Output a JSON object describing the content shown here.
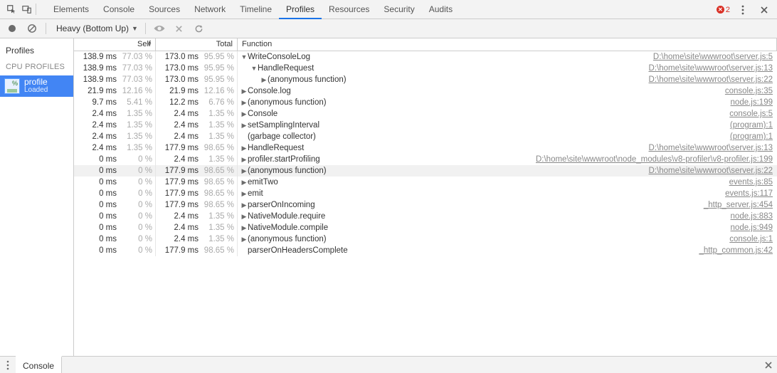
{
  "topbar": {
    "tabs": [
      "Elements",
      "Console",
      "Sources",
      "Network",
      "Timeline",
      "Profiles",
      "Resources",
      "Security",
      "Audits"
    ],
    "active_tab": "Profiles",
    "error_count": "2"
  },
  "toolbar": {
    "view_label": "Heavy (Bottom Up)"
  },
  "sidebar": {
    "heading": "Profiles",
    "section": "CPU PROFILES",
    "item_label": "profile",
    "item_sub": "Loaded"
  },
  "headers": {
    "self": "Self",
    "total": "Total",
    "fn": "Function"
  },
  "rows": [
    {
      "self_ms": "138.9 ms",
      "self_pct": "77.03 %",
      "total_ms": "173.0 ms",
      "total_pct": "95.95 %",
      "indent": 0,
      "arrow": "down",
      "fn": "WriteConsoleLog",
      "link": "D:\\home\\site\\wwwroot\\server.js:5"
    },
    {
      "self_ms": "138.9 ms",
      "self_pct": "77.03 %",
      "total_ms": "173.0 ms",
      "total_pct": "95.95 %",
      "indent": 1,
      "arrow": "down",
      "fn": "HandleRequest",
      "link": "D:\\home\\site\\wwwroot\\server.js:13"
    },
    {
      "self_ms": "138.9 ms",
      "self_pct": "77.03 %",
      "total_ms": "173.0 ms",
      "total_pct": "95.95 %",
      "indent": 2,
      "arrow": "right",
      "fn": "(anonymous function)",
      "link": "D:\\home\\site\\wwwroot\\server.js:22"
    },
    {
      "self_ms": "21.9 ms",
      "self_pct": "12.16 %",
      "total_ms": "21.9 ms",
      "total_pct": "12.16 %",
      "indent": 0,
      "arrow": "right",
      "fn": "Console.log",
      "link": "console.js:35"
    },
    {
      "self_ms": "9.7 ms",
      "self_pct": "5.41 %",
      "total_ms": "12.2 ms",
      "total_pct": "6.76 %",
      "indent": 0,
      "arrow": "right",
      "fn": "(anonymous function)",
      "link": "node.js:199"
    },
    {
      "self_ms": "2.4 ms",
      "self_pct": "1.35 %",
      "total_ms": "2.4 ms",
      "total_pct": "1.35 %",
      "indent": 0,
      "arrow": "right",
      "fn": "Console",
      "link": "console.js:5"
    },
    {
      "self_ms": "2.4 ms",
      "self_pct": "1.35 %",
      "total_ms": "2.4 ms",
      "total_pct": "1.35 %",
      "indent": 0,
      "arrow": "right",
      "fn": "setSamplingInterval",
      "link": "(program):1"
    },
    {
      "self_ms": "2.4 ms",
      "self_pct": "1.35 %",
      "total_ms": "2.4 ms",
      "total_pct": "1.35 %",
      "indent": 0,
      "arrow": "none",
      "fn": "(garbage collector)",
      "link": "(program):1"
    },
    {
      "self_ms": "2.4 ms",
      "self_pct": "1.35 %",
      "total_ms": "177.9 ms",
      "total_pct": "98.65 %",
      "indent": 0,
      "arrow": "right",
      "fn": "HandleRequest",
      "link": "D:\\home\\site\\wwwroot\\server.js:13"
    },
    {
      "self_ms": "0 ms",
      "self_pct": "0 %",
      "total_ms": "2.4 ms",
      "total_pct": "1.35 %",
      "indent": 0,
      "arrow": "right",
      "fn": "profiler.startProfiling",
      "link": "D:\\home\\site\\wwwroot\\node_modules\\v8-profiler\\v8-profiler.js:199"
    },
    {
      "self_ms": "0 ms",
      "self_pct": "0 %",
      "total_ms": "177.9 ms",
      "total_pct": "98.65 %",
      "indent": 0,
      "arrow": "right",
      "fn": "(anonymous function)",
      "link": "D:\\home\\site\\wwwroot\\server.js:22",
      "selected": true
    },
    {
      "self_ms": "0 ms",
      "self_pct": "0 %",
      "total_ms": "177.9 ms",
      "total_pct": "98.65 %",
      "indent": 0,
      "arrow": "right",
      "fn": "emitTwo",
      "link": "events.js:85"
    },
    {
      "self_ms": "0 ms",
      "self_pct": "0 %",
      "total_ms": "177.9 ms",
      "total_pct": "98.65 %",
      "indent": 0,
      "arrow": "right",
      "fn": "emit",
      "link": "events.js:117"
    },
    {
      "self_ms": "0 ms",
      "self_pct": "0 %",
      "total_ms": "177.9 ms",
      "total_pct": "98.65 %",
      "indent": 0,
      "arrow": "right",
      "fn": "parserOnIncoming",
      "link": "_http_server.js:454"
    },
    {
      "self_ms": "0 ms",
      "self_pct": "0 %",
      "total_ms": "2.4 ms",
      "total_pct": "1.35 %",
      "indent": 0,
      "arrow": "right",
      "fn": "NativeModule.require",
      "link": "node.js:883"
    },
    {
      "self_ms": "0 ms",
      "self_pct": "0 %",
      "total_ms": "2.4 ms",
      "total_pct": "1.35 %",
      "indent": 0,
      "arrow": "right",
      "fn": "NativeModule.compile",
      "link": "node.js:949"
    },
    {
      "self_ms": "0 ms",
      "self_pct": "0 %",
      "total_ms": "2.4 ms",
      "total_pct": "1.35 %",
      "indent": 0,
      "arrow": "right",
      "fn": "(anonymous function)",
      "link": "console.js:1"
    },
    {
      "self_ms": "0 ms",
      "self_pct": "0 %",
      "total_ms": "177.9 ms",
      "total_pct": "98.65 %",
      "indent": 0,
      "arrow": "none",
      "fn": "parserOnHeadersComplete",
      "link": "_http_common.js:42"
    }
  ],
  "drawer": {
    "tab": "Console"
  }
}
